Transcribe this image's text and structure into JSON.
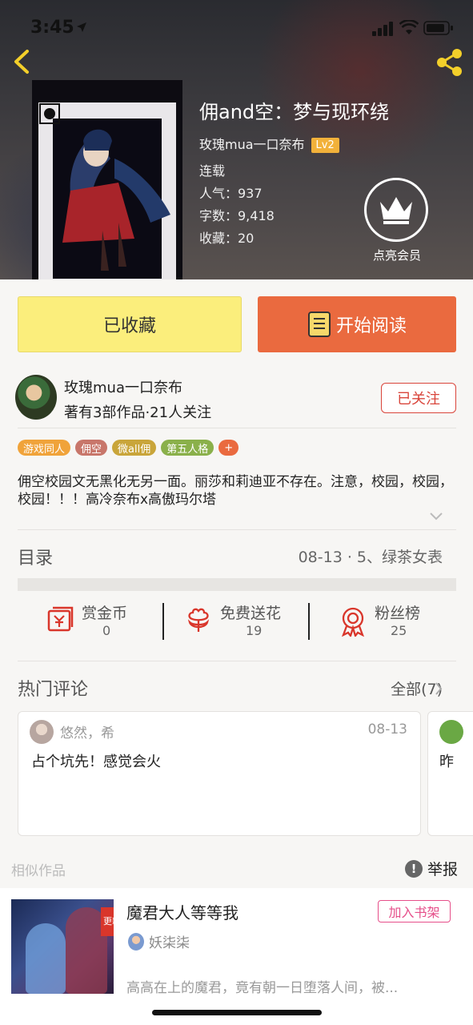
{
  "status_bar": {
    "time": "3:45"
  },
  "book": {
    "title": "佣and空：梦与现环绕",
    "author": "玫瑰mua一口奈布",
    "author_level": "Lv2",
    "status": "连载",
    "popularity": "人气：937",
    "word_count": "字数：9,418",
    "favorites": "收藏：20"
  },
  "vip": {
    "label": "点亮会员"
  },
  "actions": {
    "collected_label": "已收藏",
    "read_label": "开始阅读"
  },
  "author_card": {
    "name": "玫瑰mua一口奈布",
    "stats": "著有3部作品·21人关注",
    "follow_label": "已关注"
  },
  "tags": [
    {
      "label": "游戏同人",
      "color": "#f0a33a"
    },
    {
      "label": "佣空",
      "color": "#c8766a"
    },
    {
      "label": "微all佣",
      "color": "#c9a53a"
    },
    {
      "label": "第五人格",
      "color": "#8ab04a"
    },
    {
      "label": "+",
      "color": "#ea6a3f"
    }
  ],
  "description": "佣空校园文无黑化无另一面。丽莎和莉迪亚不存在。注意，校园，校园，校园！！！高冷奈布x高傲玛尔塔",
  "toc": {
    "label": "目录",
    "latest": "08-13 · 5、绿茶女表"
  },
  "stats": [
    {
      "label": "赏金币",
      "value": "0",
      "icon": "reward-coin-icon"
    },
    {
      "label": "免费送花",
      "value": "19",
      "icon": "flower-icon"
    },
    {
      "label": "粉丝榜",
      "value": "25",
      "icon": "medal-icon"
    }
  ],
  "hot_comments": {
    "label": "热门评论",
    "all_label": "全部(7)",
    "items": [
      {
        "user": "悠然，希",
        "date": "08-13",
        "text": "占个坑先！感觉会火"
      },
      {
        "text": "昨"
      }
    ]
  },
  "similar": {
    "label": "相似作品",
    "report_label": "举报",
    "item": {
      "badge": "更新",
      "title": "魔君大人等等我",
      "author": "妖柒柒",
      "add_label": "加入书架",
      "description": "高高在上的魔君，竟有朝一日堕落人间，被..."
    }
  },
  "colors": {
    "accent": "#ea6a3f",
    "collected_bg": "#fbee7c",
    "follow": "#d9453b",
    "shelf": "#e64f8a"
  }
}
